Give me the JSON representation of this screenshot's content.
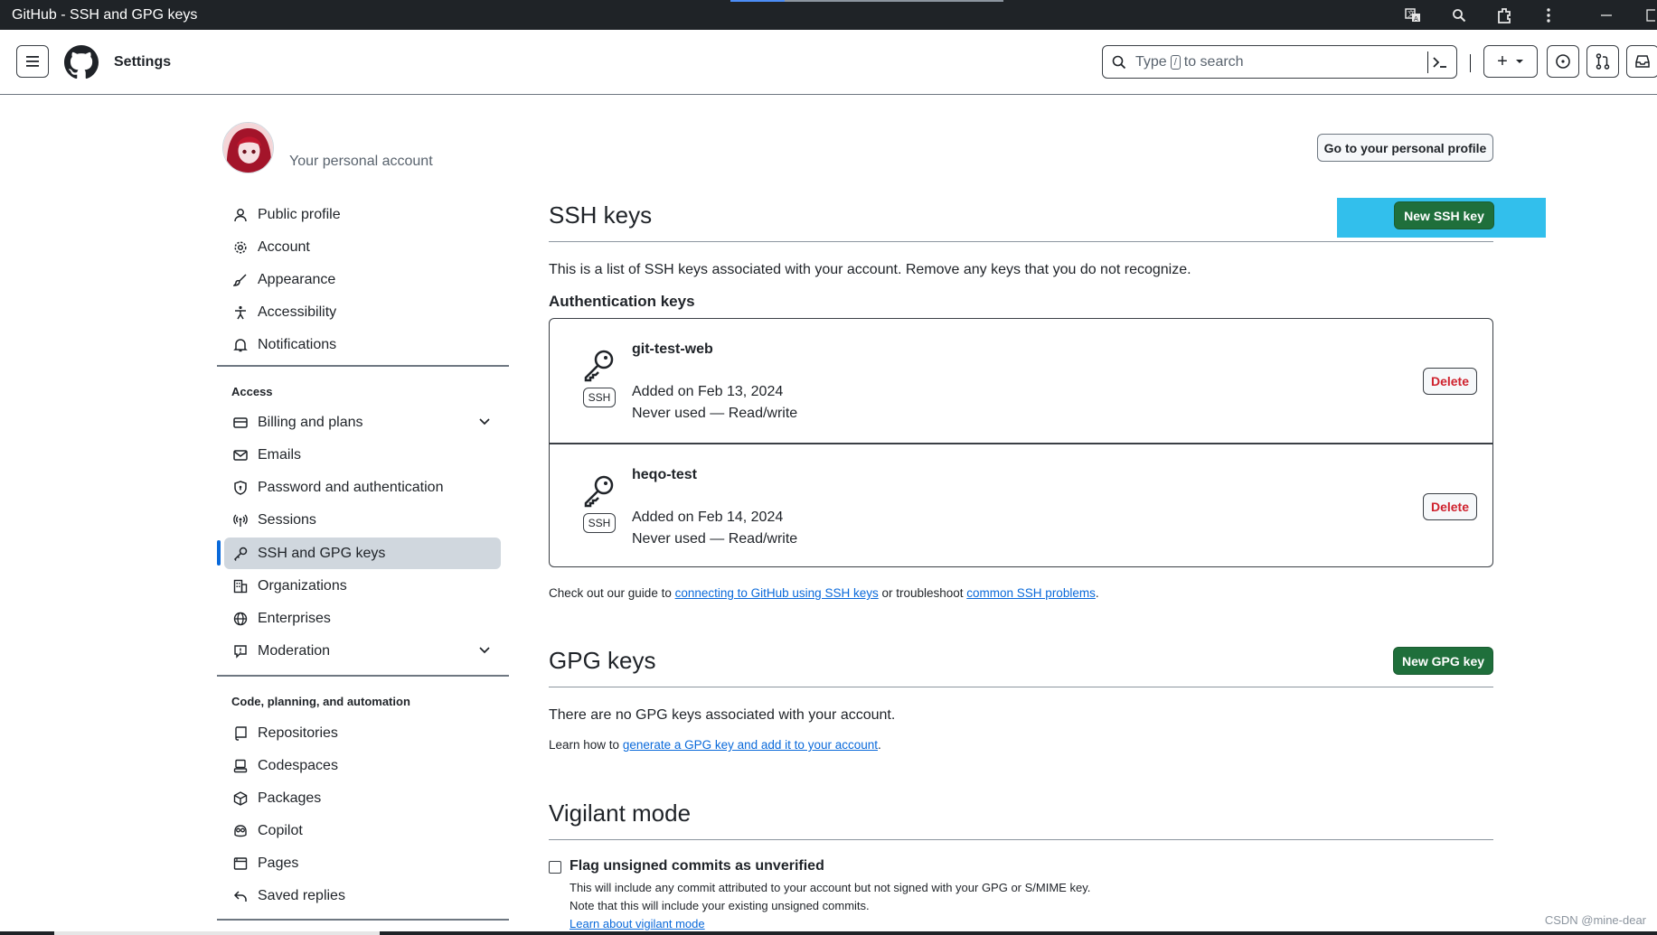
{
  "window": {
    "title": "GitHub - SSH and GPG keys"
  },
  "header": {
    "settings_label": "Settings",
    "search": {
      "prefix": "Type",
      "kbd": "/",
      "suffix": "to search"
    },
    "new_label": "+"
  },
  "profile": {
    "account_label": "Your personal account",
    "profile_button": "Go to your personal profile"
  },
  "sidebar": {
    "group1": [
      {
        "name": "public-profile",
        "label": "Public profile",
        "icon": "person-icon"
      },
      {
        "name": "account",
        "label": "Account",
        "icon": "gear-icon"
      },
      {
        "name": "appearance",
        "label": "Appearance",
        "icon": "paintbrush-icon"
      },
      {
        "name": "accessibility",
        "label": "Accessibility",
        "icon": "accessibility-icon"
      },
      {
        "name": "notifications",
        "label": "Notifications",
        "icon": "bell-icon"
      }
    ],
    "access_heading": "Access",
    "access": [
      {
        "name": "billing",
        "label": "Billing and plans",
        "icon": "credit-card-icon",
        "expandable": true
      },
      {
        "name": "emails",
        "label": "Emails",
        "icon": "mail-icon"
      },
      {
        "name": "password-auth",
        "label": "Password and authentication",
        "icon": "shield-icon"
      },
      {
        "name": "sessions",
        "label": "Sessions",
        "icon": "broadcast-icon"
      },
      {
        "name": "ssh-gpg-keys",
        "label": "SSH and GPG keys",
        "icon": "key-icon",
        "active": true
      },
      {
        "name": "organizations",
        "label": "Organizations",
        "icon": "organization-icon"
      },
      {
        "name": "enterprises",
        "label": "Enterprises",
        "icon": "globe-icon"
      },
      {
        "name": "moderation",
        "label": "Moderation",
        "icon": "report-icon",
        "expandable": true
      }
    ],
    "code_heading": "Code, planning, and automation",
    "code": [
      {
        "name": "repositories",
        "label": "Repositories",
        "icon": "repo-icon"
      },
      {
        "name": "codespaces",
        "label": "Codespaces",
        "icon": "codespaces-icon"
      },
      {
        "name": "packages",
        "label": "Packages",
        "icon": "package-icon"
      },
      {
        "name": "copilot",
        "label": "Copilot",
        "icon": "copilot-icon"
      },
      {
        "name": "pages",
        "label": "Pages",
        "icon": "browser-icon"
      },
      {
        "name": "saved-replies",
        "label": "Saved replies",
        "icon": "reply-icon"
      }
    ]
  },
  "ssh": {
    "heading": "SSH keys",
    "new_button": "New SSH key",
    "description": "This is a list of SSH keys associated with your account. Remove any keys that you do not recognize.",
    "auth_heading": "Authentication keys",
    "keys": [
      {
        "title": "git-test-web",
        "added": "Added on Feb 13, 2024",
        "usage": "Never used — Read/write",
        "tag": "SSH",
        "delete": "Delete"
      },
      {
        "title": "heqo-test",
        "added": "Added on Feb 14, 2024",
        "usage": "Never used — Read/write",
        "tag": "SSH",
        "delete": "Delete"
      }
    ],
    "guide_prefix": "Check out our guide to ",
    "guide_link1": "connecting to GitHub using SSH keys",
    "guide_middle": " or troubleshoot ",
    "guide_link2": "common SSH problems",
    "guide_suffix": "."
  },
  "gpg": {
    "heading": "GPG keys",
    "new_button": "New GPG key",
    "none": "There are no GPG keys associated with your account.",
    "learn_prefix": "Learn how to ",
    "learn_link": "generate a GPG key and add it to your account",
    "learn_suffix": "."
  },
  "vigilant": {
    "heading": "Vigilant mode",
    "checkbox_label": "Flag unsigned commits as unverified",
    "checked": false,
    "line1": "This will include any commit attributed to your account but not signed with your GPG or S/MIME key.",
    "line2": "Note that this will include your existing unsigned commits.",
    "learn_link": "Learn about vigilant mode"
  },
  "watermark": "CSDN @mine-dear",
  "colors": {
    "accent": "#0969da",
    "primary_button": "#1f6f3b",
    "danger": "#cf222e",
    "highlight": "#1cb8ea"
  }
}
